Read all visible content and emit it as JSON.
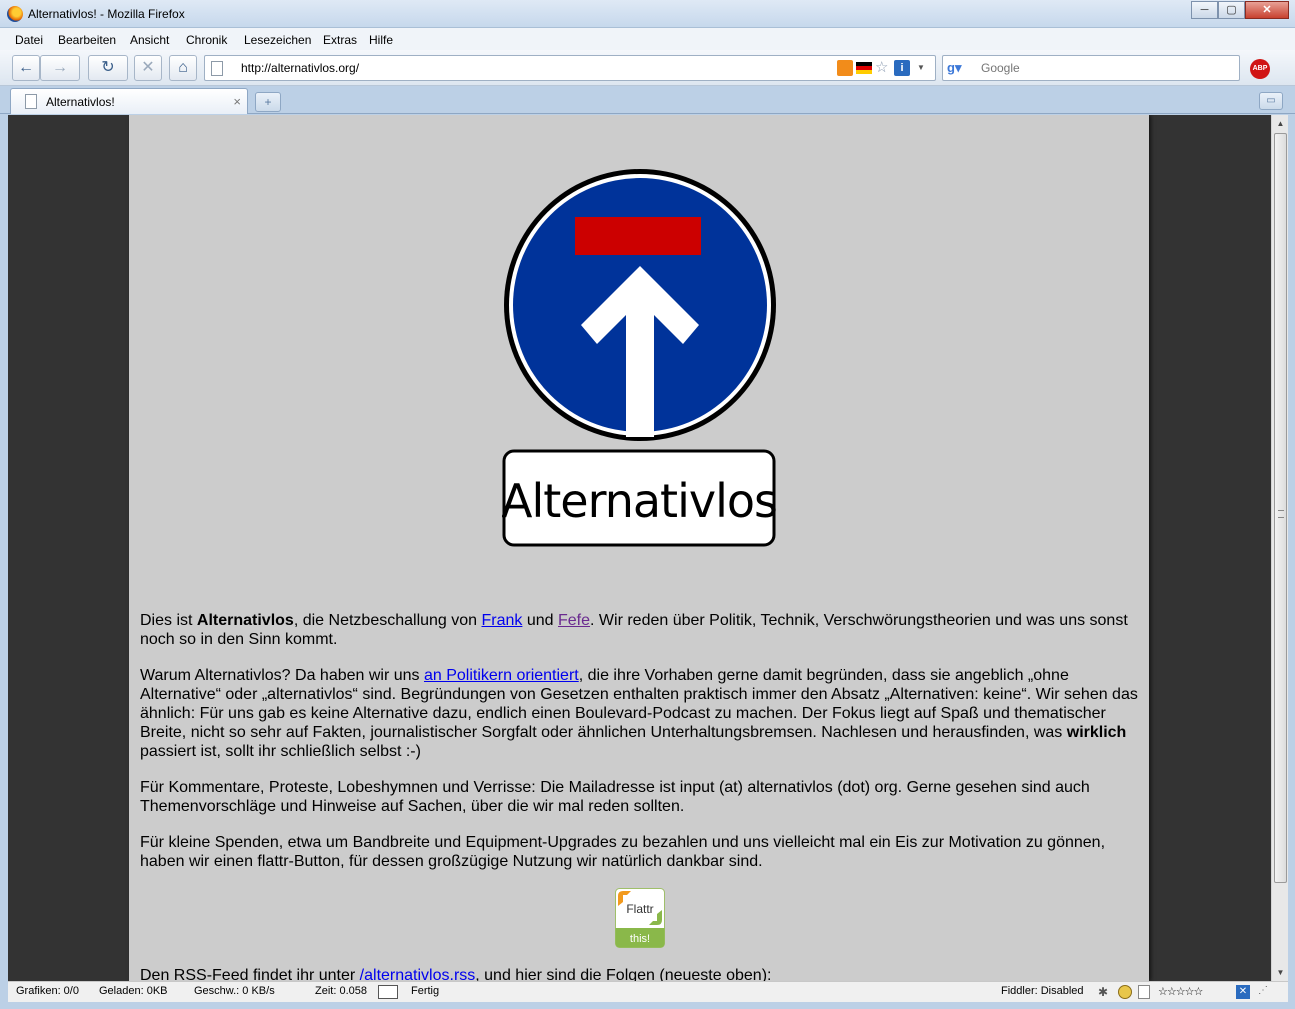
{
  "window": {
    "title": "Alternativlos! - Mozilla Firefox",
    "buttons": {
      "minimize": "─",
      "maximize": "▢",
      "close": "✕"
    }
  },
  "menu": [
    "Datei",
    "Bearbeiten",
    "Ansicht",
    "Chronik",
    "Lesezeichen",
    "Extras",
    "Hilfe"
  ],
  "toolbar": {
    "back": "←",
    "forward": "→",
    "reload": "↻",
    "stop": "✕",
    "home": "⌂",
    "url": "http://alternativlos.org/",
    "search_placeholder": "Google",
    "abp": "ABP"
  },
  "tabs": [
    {
      "label": "Alternativlos!",
      "close": "×"
    }
  ],
  "tabbar": {
    "new_tab": "+",
    "list_tabs": "▭"
  },
  "sign": {
    "text": "Alternativlos",
    "colors": {
      "blue": "#00339a",
      "red": "#cc0000",
      "white": "#ffffff",
      "black": "#000000"
    }
  },
  "content": {
    "p1": {
      "a": "Dies ist ",
      "b": "Alternativlos",
      "c": ", die Netzbeschallung von ",
      "link1": "Frank",
      "d": " und ",
      "link2": "Fefe",
      "e": ". Wir reden über Politik, Technik, Verschwörungstheorien und was uns sonst noch so in den Sinn kommt."
    },
    "p2": {
      "a": "Warum Alternativlos? Da haben wir uns ",
      "link": "an Politikern orientiert",
      "b": ", die ihre Vorhaben gerne damit begründen, dass sie angeblich „ohne Alternative“ oder „alternativlos“ sind. Begründungen von Gesetzen enthalten praktisch immer den Absatz „Alternativen: keine“. Wir sehen das ähnlich: Für uns gab es keine Alternative dazu, endlich einen Boulevard-Podcast zu machen. Der Fokus liegt auf Spaß und thematischer Breite, nicht so sehr auf Fakten, journalistischer Sorgfalt oder ähnlichen Unterhaltungsbremsen. Nachlesen und herausfinden, was ",
      "bold": "wirklich",
      "c": " passiert ist, sollt ihr schließlich selbst :-)"
    },
    "p3": "Für Kommentare, Proteste, Lobeshymnen und Verrisse: Die Mailadresse ist input (at) alternativlos (dot) org. Gerne gesehen sind auch Themenvorschläge und Hinweise auf Sachen, über die wir mal reden sollten.",
    "p4": "Für kleine Spenden, etwa um Bandbreite und Equipment-Upgrades zu bezahlen und uns vielleicht mal ein Eis zur Motivation zu gönnen, haben wir einen flattr-Button, für dessen großzügige Nutzung wir natürlich dankbar sind.",
    "flattr": {
      "top": "Flattr",
      "bottom": "this!"
    },
    "p5": {
      "a": "Den RSS-Feed findet ihr unter ",
      "link": "/alternativlos.rss",
      "b": ", und hier sind die Folgen (neueste oben):"
    }
  },
  "status": {
    "images": "Grafiken: 0/0",
    "loaded": "Geladen: 0KB",
    "speed": "Geschw.: 0 KB/s",
    "time": "Zeit: 0.058",
    "done": "Fertig",
    "fiddler": "Fiddler: Disabled",
    "stars": "☆☆☆☆☆"
  }
}
